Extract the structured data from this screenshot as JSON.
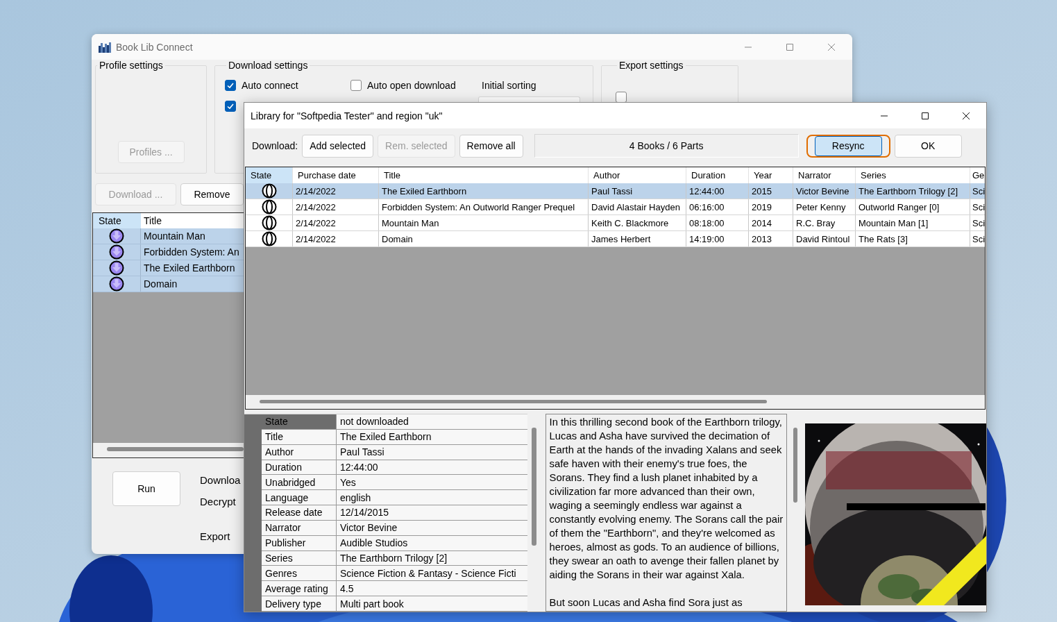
{
  "main_window": {
    "title": "Book Lib Connect",
    "profile_settings": {
      "label": "Profile settings",
      "button": {
        "label": "Profiles ...",
        "disabled": true
      }
    },
    "download_settings": {
      "label": "Download settings",
      "checkboxes": [
        {
          "label": "Auto connect",
          "checked": true
        },
        {
          "label": "Auto open download",
          "checked": false
        },
        {
          "checked": true
        }
      ],
      "initial_sorting": {
        "label": "Initial sorting"
      }
    },
    "export_settings": {
      "label": "Export settings",
      "checkboxes": [
        {
          "checked": false
        }
      ]
    },
    "actions": [
      {
        "label": "Download ...",
        "disabled": true
      },
      {
        "label": "Remove",
        "disabled": false
      }
    ],
    "table": {
      "state_column": "State",
      "columns": [
        "Title"
      ],
      "rows": [
        {
          "queued": true,
          "title": "Mountain Man",
          "selected": true
        },
        {
          "queued": true,
          "title": "Forbidden System: An",
          "selected": true
        },
        {
          "queued": true,
          "title": "The Exiled Earthborn",
          "selected": true
        },
        {
          "queued": true,
          "title": "Domain",
          "selected": true
        }
      ]
    },
    "run_button": {
      "label": "Run"
    },
    "steps": [
      "Downloa",
      "Decrypt",
      "Export"
    ]
  },
  "dialog": {
    "title": "Library for \"Softpedia Tester\" and region \"uk\"",
    "toolbar": {
      "label": "Download:",
      "buttons": [
        {
          "label": "Add selected",
          "disabled": false
        },
        {
          "label": "Rem. selected",
          "disabled": true
        },
        {
          "label": "Remove all",
          "disabled": false
        }
      ],
      "status": "4 Books / 6 Parts",
      "resync": {
        "label": "Resync",
        "focused": true
      },
      "ok": {
        "label": "OK"
      }
    },
    "table": {
      "state_column": "State",
      "columns": [
        "Purchase date",
        "Title",
        "Author",
        "Duration",
        "Year",
        "Narrator",
        "Series",
        "Ge"
      ],
      "rows": [
        {
          "queued": false,
          "selected": true,
          "cells": [
            "2/14/2022",
            "The Exiled Earthborn",
            "Paul Tassi",
            "12:44:00",
            "2015",
            "Victor Bevine",
            "The Earthborn Trilogy [2]",
            "Sci"
          ]
        },
        {
          "queued": false,
          "selected": false,
          "cells": [
            "2/14/2022",
            "Forbidden System: An Outworld Ranger Prequel",
            "David Alastair Hayden",
            "06:16:00",
            "2019",
            "Peter Kenny",
            "Outworld Ranger [0]",
            "Sci"
          ]
        },
        {
          "queued": false,
          "selected": false,
          "cells": [
            "2/14/2022",
            "Mountain Man",
            "Keith C. Blackmore",
            "08:18:00",
            "2014",
            "R.C. Bray",
            "Mountain Man [1]",
            "Sci"
          ]
        },
        {
          "queued": false,
          "selected": false,
          "cells": [
            "2/14/2022",
            "Domain",
            "James Herbert",
            "14:19:00",
            "2013",
            "David Rintoul",
            "The Rats [3]",
            "Sci"
          ]
        }
      ]
    },
    "details": {
      "rows": [
        {
          "key": "State",
          "value": "not downloaded",
          "selected": true
        },
        {
          "key": "Title",
          "value": "The Exiled Earthborn",
          "selected": false
        },
        {
          "key": "Author",
          "value": "Paul Tassi",
          "selected": false
        },
        {
          "key": "Duration",
          "value": "12:44:00",
          "selected": false
        },
        {
          "key": "Unabridged",
          "value": "Yes",
          "selected": false
        },
        {
          "key": "Language",
          "value": "english",
          "selected": false
        },
        {
          "key": "Release date",
          "value": "12/14/2015",
          "selected": false
        },
        {
          "key": "Narrator",
          "value": "Victor Bevine",
          "selected": false
        },
        {
          "key": "Publisher",
          "value": "Audible Studios",
          "selected": false
        },
        {
          "key": "Series",
          "value": "The Earthborn Trilogy [2]",
          "selected": false
        },
        {
          "key": "Genres",
          "value": "Science Fiction & Fantasy - Science Ficti",
          "selected": false
        },
        {
          "key": "Average rating",
          "value": "4.5",
          "selected": false
        },
        {
          "key": "Delivery type",
          "value": "Multi part book",
          "selected": false
        }
      ]
    },
    "description": [
      "In this thrilling second book of the Earthborn trilogy, Lucas and Asha have survived the decimation of Earth at the hands of the invading Xalans and seek safe haven with their enemy's true foes, the Sorans. They find a lush planet inhabited by a civilization far more advanced than their own, waging a seemingly endless war against a constantly evolving enemy. The Sorans call the pair of them the \"Earthborn\", and they're welcomed as heroes, almost as gods. To an audience of billions, they swear an oath to avenge their fallen planet by aiding the Sorans in their war against Xala.",
      "But soon Lucas and Asha find Sora just as"
    ],
    "cover": {
      "kind": "picture"
    }
  }
}
